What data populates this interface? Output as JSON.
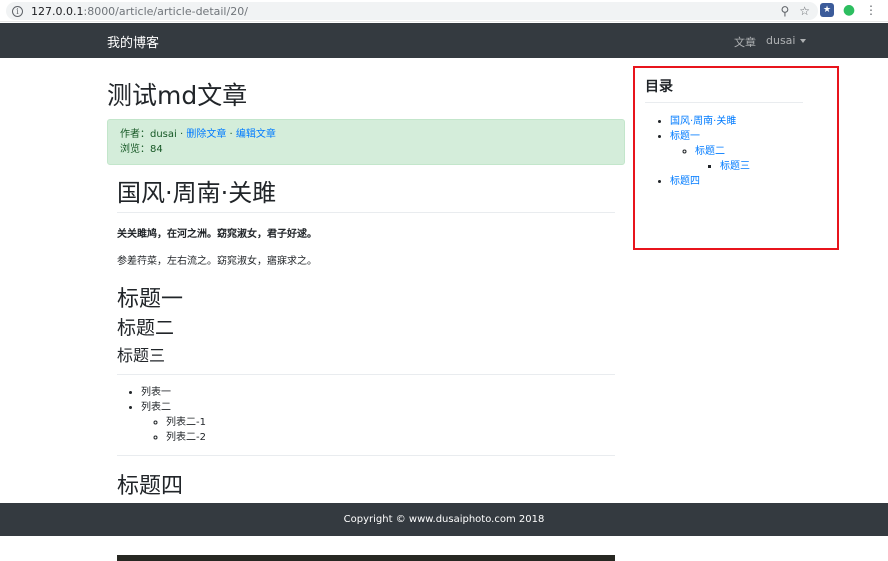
{
  "browser": {
    "url_host": "127.0.0.1",
    "url_rest": ":8000/article/article-detail/20/",
    "icons": [
      "info-icon",
      "zoom-icon",
      "star-icon",
      "extension-icon",
      "evernote-icon",
      "menu-icon"
    ]
  },
  "navbar": {
    "brand": "我的博客",
    "links": [
      "文章",
      "dusai"
    ]
  },
  "article": {
    "title": "测试md文章",
    "meta": {
      "author_label": "作者：dusai",
      "sep1": " · ",
      "delete_link": "删除文章",
      "sep2": " · ",
      "edit_link": "编辑文章",
      "views": "浏览：84"
    },
    "body": {
      "h1": "国风·周南·关雎",
      "p_bold": "关关雎鸠，在河之洲。窈窕淑女，君子好逑。",
      "p_plain": "参差荇菜，左右流之。窈窕淑女，寤寐求之。",
      "h_one": "标题一",
      "h_two": "标题二",
      "h_three": "标题三",
      "list": [
        "列表一",
        "列表二"
      ],
      "sublist": [
        "列表二-1",
        "列表二-2"
      ],
      "h_four": "标题四"
    }
  },
  "toc": {
    "title": "目录",
    "items": [
      "国风·周南·关雎",
      "标题一",
      "标题二",
      "标题三",
      "标题四"
    ]
  },
  "footer": {
    "text": "Copyright © www.dusaiphoto.com 2018"
  }
}
